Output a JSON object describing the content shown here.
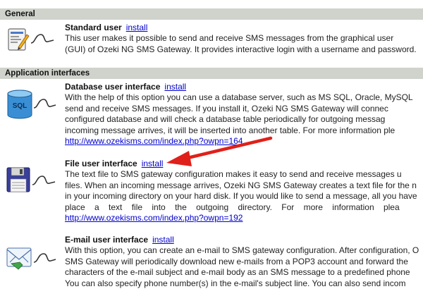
{
  "sections": {
    "general": "General",
    "app_interfaces": "Application interfaces"
  },
  "entries": {
    "standard": {
      "title": "Standard user",
      "install": "install",
      "lines": [
        "This user makes it possible to send and receive SMS messages from the graphical user",
        "(GUI) of Ozeki NG SMS Gateway. It provides interactive login with a username and password."
      ]
    },
    "database": {
      "title": "Database user interface",
      "install": "install",
      "lines": [
        "With the help of this option you can use a database server, such as MS SQL, Oracle, MySQL",
        "send and receive SMS messages. If you install it, Ozeki NG SMS Gateway will connec",
        "configured database and will check a database table periodically for outgoing messag",
        "incoming message arrives, it will be inserted into another table. For more information ple"
      ],
      "link": "http://www.ozekisms.com/index.php?owpn=164"
    },
    "file": {
      "title": "File user interface",
      "install": "install",
      "lines": [
        "The text file to SMS gateway configuration makes it easy to send and receive messages u",
        "files. When an incoming message arrives, Ozeki NG SMS Gateway creates a text file for the n",
        "in your incoming directory on your hard disk. If you would like to send a message, all you have",
        "place    a    text    file    into    the    outgoing    directory.    For    more    information    plea"
      ],
      "link": "http://www.ozekisms.com/index.php?owpn=192"
    },
    "email": {
      "title": "E-mail user interface",
      "install": "install",
      "lines": [
        "With this option, you can create an e-mail to SMS gateway configuration. After configuration, O",
        "SMS Gateway will periodically download new e-mails from a POP3 account and forward the",
        "characters of the e-mail subject and e-mail body as an SMS message to a predefined phone",
        "You can also specify phone number(s) in the e-mail's subject line. You can also send incom"
      ]
    }
  },
  "icons": {
    "standard": "user-form-icon",
    "database": "sql-database-icon",
    "file": "floppy-disk-icon",
    "email": "email-envelope-icon"
  },
  "colors": {
    "header_bg": "#cfd3cc",
    "link": "#0000cc",
    "arrow": "#e0201a"
  },
  "arrow_label_note": ""
}
